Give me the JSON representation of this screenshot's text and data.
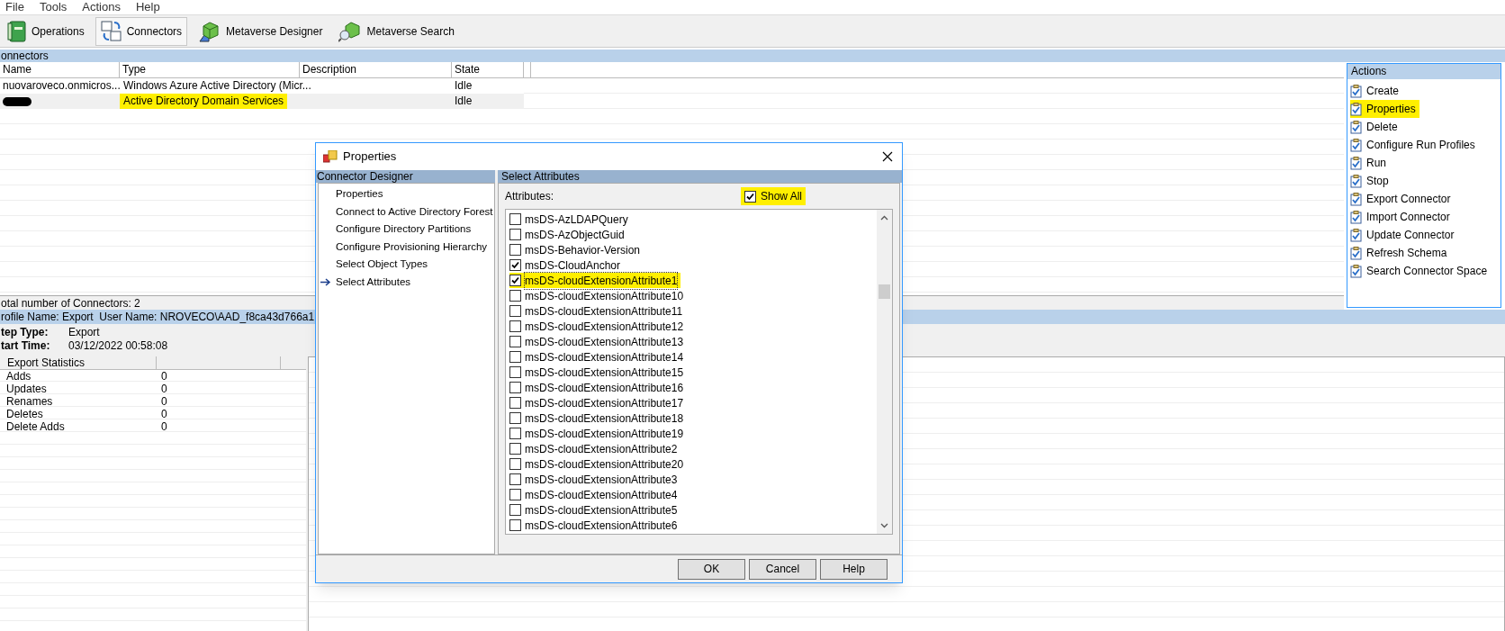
{
  "menu": [
    "File",
    "Tools",
    "Actions",
    "Help"
  ],
  "toolbar": [
    {
      "label": "Operations",
      "selected": false
    },
    {
      "label": "Connectors",
      "selected": true
    },
    {
      "label": "Metaverse Designer",
      "selected": false
    },
    {
      "label": "Metaverse Search",
      "selected": false
    }
  ],
  "connectors": {
    "title": "onnectors",
    "columns": [
      "Name",
      "Type",
      "Description",
      "State"
    ],
    "rows": [
      {
        "name": "nuovaroveco.onmicros...",
        "type": "Windows Azure Active Directory (Micr...",
        "state": "Idle",
        "selected": false,
        "redacted": false,
        "highlighted": false
      },
      {
        "type": "Active Directory Domain Services",
        "state": "Idle",
        "selected": true,
        "redacted": true,
        "highlighted": true
      }
    ],
    "status": "otal number of Connectors: 2"
  },
  "actions": {
    "title": "Actions",
    "items": [
      {
        "label": "Create",
        "highlighted": false
      },
      {
        "label": "Properties",
        "highlighted": true
      },
      {
        "label": "Delete",
        "highlighted": false
      },
      {
        "label": "Configure Run Profiles",
        "highlighted": false
      },
      {
        "label": "Run",
        "highlighted": false
      },
      {
        "label": "Stop",
        "highlighted": false
      },
      {
        "label": "Export Connector",
        "highlighted": false
      },
      {
        "label": "Import Connector",
        "highlighted": false
      },
      {
        "label": "Update Connector",
        "highlighted": false
      },
      {
        "label": "Refresh Schema",
        "highlighted": false
      },
      {
        "label": "Search Connector Space",
        "highlighted": false
      }
    ]
  },
  "profile": {
    "bar": "rofile Name: Export  User Name: NROVECO\\AAD_f8ca43d766a1",
    "fields": [
      {
        "label": "tep Type:",
        "value": "Export"
      },
      {
        "label": "tart Time:",
        "value": "03/12/2022 00:58:08"
      }
    ],
    "stats": {
      "title": "Export Statistics",
      "rows": [
        {
          "label": "Adds",
          "value": "0"
        },
        {
          "label": "Updates",
          "value": "0"
        },
        {
          "label": "Renames",
          "value": "0"
        },
        {
          "label": "Deletes",
          "value": "0"
        },
        {
          "label": "Delete Adds",
          "value": "0"
        }
      ]
    }
  },
  "dialog": {
    "title": "Properties",
    "left_title": "Connector Designer",
    "steps": [
      {
        "label": "Properties",
        "selected": false
      },
      {
        "label": "Connect to Active Directory Forest",
        "selected": false
      },
      {
        "label": "Configure Directory Partitions",
        "selected": false
      },
      {
        "label": "Configure Provisioning Hierarchy",
        "selected": false
      },
      {
        "label": "Select Object Types",
        "selected": false
      },
      {
        "label": "Select Attributes",
        "selected": true
      }
    ],
    "right_title": "Select Attributes",
    "attributes_label": "Attributes:",
    "show_all": {
      "label": "Show All",
      "checked": true,
      "highlighted": true
    },
    "attributes": [
      {
        "label": "msDS-AzLDAPQuery",
        "checked": false,
        "highlighted": false
      },
      {
        "label": "msDS-AzObjectGuid",
        "checked": false,
        "highlighted": false
      },
      {
        "label": "msDS-Behavior-Version",
        "checked": false,
        "highlighted": false
      },
      {
        "label": "msDS-CloudAnchor",
        "checked": true,
        "highlighted": false
      },
      {
        "label": "msDS-cloudExtensionAttribute1",
        "checked": true,
        "highlighted": true
      },
      {
        "label": "msDS-cloudExtensionAttribute10",
        "checked": false,
        "highlighted": false
      },
      {
        "label": "msDS-cloudExtensionAttribute11",
        "checked": false,
        "highlighted": false
      },
      {
        "label": "msDS-cloudExtensionAttribute12",
        "checked": false,
        "highlighted": false
      },
      {
        "label": "msDS-cloudExtensionAttribute13",
        "checked": false,
        "highlighted": false
      },
      {
        "label": "msDS-cloudExtensionAttribute14",
        "checked": false,
        "highlighted": false
      },
      {
        "label": "msDS-cloudExtensionAttribute15",
        "checked": false,
        "highlighted": false
      },
      {
        "label": "msDS-cloudExtensionAttribute16",
        "checked": false,
        "highlighted": false
      },
      {
        "label": "msDS-cloudExtensionAttribute17",
        "checked": false,
        "highlighted": false
      },
      {
        "label": "msDS-cloudExtensionAttribute18",
        "checked": false,
        "highlighted": false
      },
      {
        "label": "msDS-cloudExtensionAttribute19",
        "checked": false,
        "highlighted": false
      },
      {
        "label": "msDS-cloudExtensionAttribute2",
        "checked": false,
        "highlighted": false
      },
      {
        "label": "msDS-cloudExtensionAttribute20",
        "checked": false,
        "highlighted": false
      },
      {
        "label": "msDS-cloudExtensionAttribute3",
        "checked": false,
        "highlighted": false
      },
      {
        "label": "msDS-cloudExtensionAttribute4",
        "checked": false,
        "highlighted": false
      },
      {
        "label": "msDS-cloudExtensionAttribute5",
        "checked": false,
        "highlighted": false
      },
      {
        "label": "msDS-cloudExtensionAttribute6",
        "checked": false,
        "highlighted": false
      }
    ],
    "buttons": [
      "OK",
      "Cancel",
      "Help"
    ]
  }
}
